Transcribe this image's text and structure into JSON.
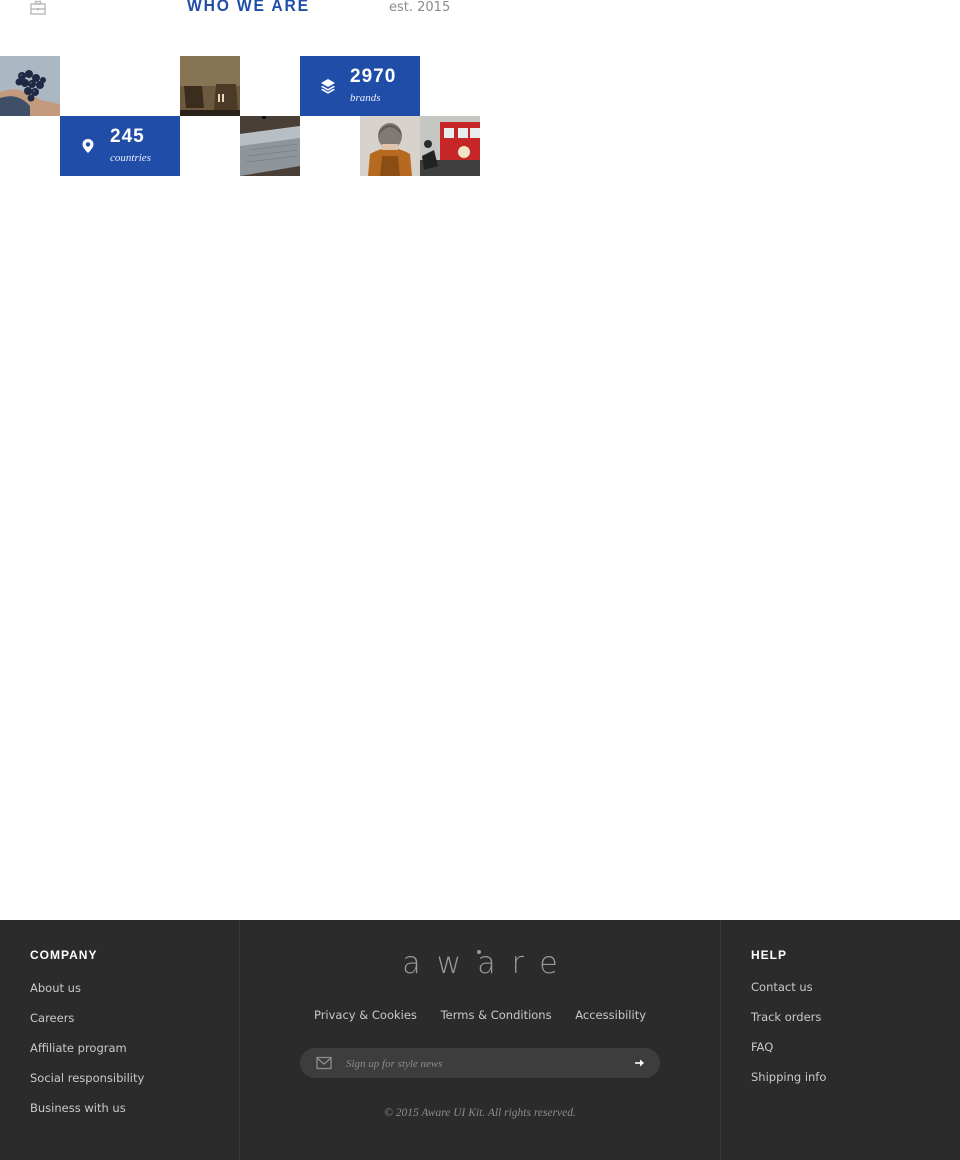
{
  "header": {
    "briefcase_icon": "briefcase-icon",
    "title": "WHO WE ARE",
    "established": "est. 2015"
  },
  "stats": [
    {
      "value": "2970",
      "label": "brands",
      "icon": "layers-icon"
    },
    {
      "value": "245",
      "label": "countries",
      "icon": "map-pin-icon"
    }
  ],
  "mosaic": {
    "photos": [
      "grapes-photo",
      "boots-photo",
      "laptop-photo",
      "hooded-person-photo",
      "red-tram-photo"
    ]
  },
  "footer": {
    "company": {
      "heading": "COMPANY",
      "links": [
        "About us",
        "Careers",
        "Affiliate program",
        "Social responsibility",
        "Business with us"
      ]
    },
    "logo": "aware",
    "policy_links": [
      "Privacy & Cookies",
      "Terms & Conditions",
      "Accessibility"
    ],
    "signup": {
      "placeholder": "Sign up for style news",
      "icon": "mail-icon",
      "submit_icon": "arrow-right-icon"
    },
    "copyright": "© 2015 Aware UI Kit. All rights reserved.",
    "help": {
      "heading": "HELP",
      "links": [
        "Contact us",
        "Track orders",
        "FAQ",
        "Shipping info"
      ]
    }
  },
  "colors": {
    "accent": "#1f4da8",
    "footer_bg": "#2b2b2b",
    "footer_text": "#c9c9c9"
  }
}
